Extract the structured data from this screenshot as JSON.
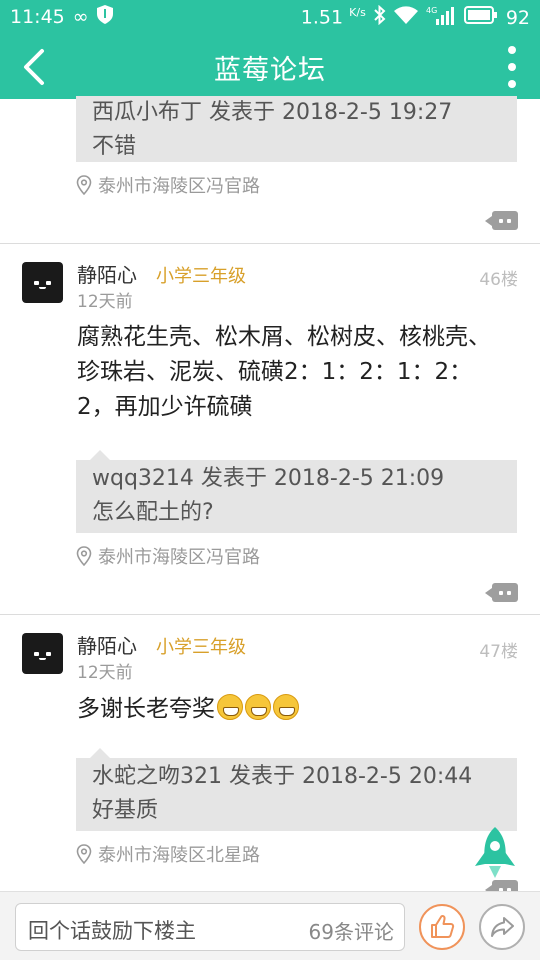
{
  "status_bar": {
    "time": "11:45",
    "net_speed": "1.51",
    "net_unit": "K/s",
    "network_type": "4G",
    "battery": "92"
  },
  "header": {
    "title": "蓝莓论坛"
  },
  "posts": [
    {
      "quote_author_line": "西瓜小布丁 发表于 2018-2-5 19:27",
      "quote_text": "不错",
      "location": "泰州市海陵区冯官路"
    },
    {
      "username": "静陌心",
      "grade": "小学三年级",
      "time_ago": "12天前",
      "floor": "46楼",
      "content": "腐熟花生壳、松木屑、松树皮、核桃壳、珍珠岩、泥炭、硫磺2：1：2：1：2：2，再加少许硫磺",
      "quote_author_line": "wqq3214 发表于 2018-2-5 21:09",
      "quote_text": "怎么配土的?",
      "location": "泰州市海陵区冯官路"
    },
    {
      "username": "静陌心",
      "grade": "小学三年级",
      "time_ago": "12天前",
      "floor": "47楼",
      "content": "多谢长老夸奖",
      "quote_author_line": "水蛇之吻321 发表于 2018-2-5 20:44",
      "quote_text": "好基质",
      "location": "泰州市海陵区北星路"
    }
  ],
  "bottom_bar": {
    "reply_placeholder": "回个话鼓励下楼主",
    "comment_count": "69条评论"
  },
  "colors": {
    "brand": "#2cc3a1",
    "grade": "#d8a02a",
    "like": "#f0935a"
  }
}
